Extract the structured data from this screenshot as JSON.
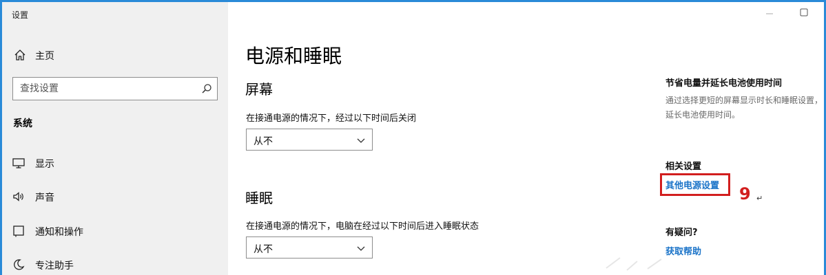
{
  "window": {
    "title": "设置"
  },
  "sidebar": {
    "home_label": "主页",
    "search_placeholder": "查找设置",
    "section_label": "系统",
    "items": [
      {
        "label": "显示",
        "icon": "monitor-icon"
      },
      {
        "label": "声音",
        "icon": "speaker-icon"
      },
      {
        "label": "通知和操作",
        "icon": "notification-icon"
      },
      {
        "label": "专注助手",
        "icon": "moon-icon"
      }
    ]
  },
  "main": {
    "title": "电源和睡眠",
    "screen": {
      "heading": "屏幕",
      "description": "在接通电源的情况下，经过以下时间后关闭",
      "value": "从不"
    },
    "sleep": {
      "heading": "睡眠",
      "description": "在接通电源的情况下，电脑在经过以下时间后进入睡眠状态",
      "value": "从不"
    }
  },
  "right_panel": {
    "tip_heading": "节省电量并延长电池使用时间",
    "tip_text": "通过选择更短的屏幕显示时长和睡眠设置，延长电池使用时间。",
    "related_heading": "相关设置",
    "related_link": "其他电源设置",
    "help_heading": "有疑问?",
    "help_link": "获取帮助"
  },
  "annotation": {
    "number": "9",
    "mark": "↵"
  },
  "colors": {
    "accent": "#2a8ad8",
    "link": "#1a73c8",
    "annotation": "#d21e1e",
    "sidebar_bg": "#f0f0f0"
  }
}
